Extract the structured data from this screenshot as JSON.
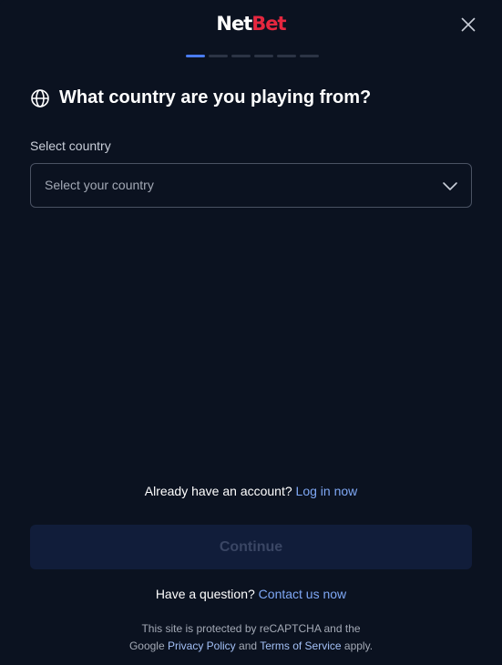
{
  "logo": {
    "part1": "Net",
    "part2": "Bet"
  },
  "progress": {
    "total_steps": 6,
    "current_step": 1
  },
  "heading": {
    "title": "What country are you playing from?"
  },
  "country_field": {
    "label": "Select country",
    "placeholder": "Select your country"
  },
  "login": {
    "prompt": "Already have an account?",
    "link": "Log in now"
  },
  "continue_label": "Continue",
  "contact": {
    "prompt": "Have a question?",
    "link": "Contact us now"
  },
  "recaptcha": {
    "line1": "This site is protected by reCAPTCHA and the",
    "prefix": "Google",
    "privacy_link": "Privacy Policy",
    "and": "and",
    "terms_link": "Terms of Service",
    "suffix": "apply."
  },
  "colors": {
    "background": "#0b1220",
    "brand_red": "#e5273f",
    "progress_active": "#4a7cf0",
    "link": "#7fa8f5",
    "button_disabled": "#111d3a"
  },
  "icons": [
    "globe-icon",
    "close-icon",
    "chevron-down-icon"
  ]
}
